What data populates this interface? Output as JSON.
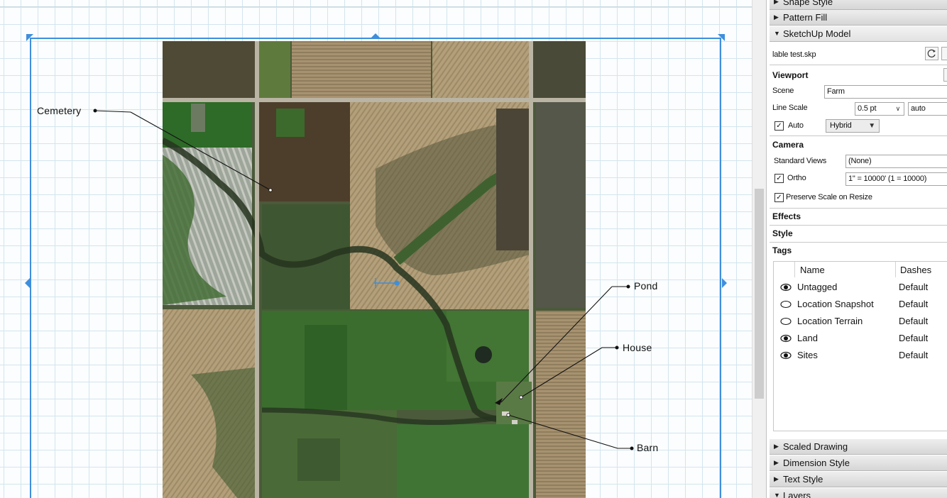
{
  "canvas": {
    "callouts": {
      "cemetery": "Cemetery",
      "pond": "Pond",
      "house": "House",
      "barn": "Barn"
    },
    "colors": {
      "selection": "#3d8fde",
      "grid": "#d3e5ee"
    }
  },
  "tray": {
    "sections_top": {
      "shape_style": "Shape Style",
      "pattern_fill": "Pattern Fill",
      "sketchup_model": "SketchUp Model"
    },
    "model": {
      "filename": "lable test.skp",
      "refresh_icon": "refresh-icon"
    },
    "viewport": {
      "heading": "Viewport",
      "scene_label": "Scene",
      "scene_value": "Farm",
      "line_scale_label": "Line Scale",
      "line_scale_value": "0.5 pt",
      "line_scale_auto": "auto",
      "auto_label": "Auto",
      "auto_checked": true,
      "render_mode": "Hybrid"
    },
    "camera": {
      "heading": "Camera",
      "standard_views_label": "Standard Views",
      "standard_views_value": "(None)",
      "ortho_label": "Ortho",
      "ortho_checked": true,
      "ortho_value": "1\" = 10000' (1 = 10000)",
      "preserve_scale_label": "Preserve Scale on Resize",
      "preserve_scale_checked": true
    },
    "effects_heading": "Effects",
    "style_heading": "Style",
    "tags": {
      "heading": "Tags",
      "columns": {
        "name": "Name",
        "dashes": "Dashes"
      },
      "rows": [
        {
          "name": "Untagged",
          "dashes": "Default",
          "visible": true
        },
        {
          "name": "Location Snapshot",
          "dashes": "Default",
          "visible": false
        },
        {
          "name": "Location Terrain",
          "dashes": "Default",
          "visible": false
        },
        {
          "name": "Land",
          "dashes": "Default",
          "visible": true
        },
        {
          "name": "Sites",
          "dashes": "Default",
          "visible": true
        }
      ]
    },
    "sections_bottom": {
      "scaled_drawing": "Scaled Drawing",
      "dimension_style": "Dimension Style",
      "text_style": "Text Style",
      "layers": "Layers"
    }
  }
}
